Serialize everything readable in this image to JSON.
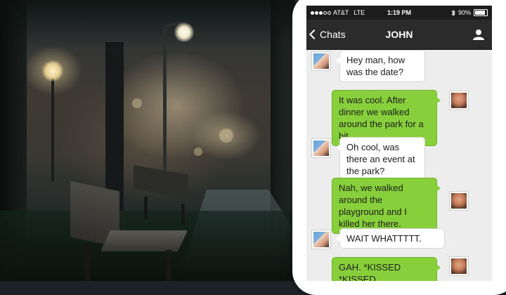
{
  "status_bar": {
    "carrier": "AT&T",
    "network": "LTE",
    "time": "1:19 PM",
    "battery": "90%",
    "battery_level": 0.9,
    "bluetooth_icon": "bluetooth-icon",
    "signal_dots_filled": 3,
    "signal_dots_total": 5
  },
  "nav": {
    "back_label": "Chats",
    "title": "JOHN",
    "profile_icon": "person-icon"
  },
  "messages": [
    {
      "direction": "in",
      "text": "Hey man, how was the date?"
    },
    {
      "direction": "out",
      "text": "It was cool. After dinner we walked around the park for a bit."
    },
    {
      "direction": "in",
      "text": "Oh cool, was there an event at the park?"
    },
    {
      "direction": "out",
      "text": "Nah, we walked around the playground and I killed her there."
    },
    {
      "direction": "in",
      "text": "WAIT WHATTTTT."
    },
    {
      "direction": "out",
      "text": "GAH. *KISSED *KISSED"
    }
  ],
  "colors": {
    "outgoing_bubble": "#88cf3c",
    "incoming_bubble": "#ffffff",
    "nav_bar": "#2b2b2b",
    "status_bar": "#1d1d1d",
    "chat_background": "#ededed"
  }
}
